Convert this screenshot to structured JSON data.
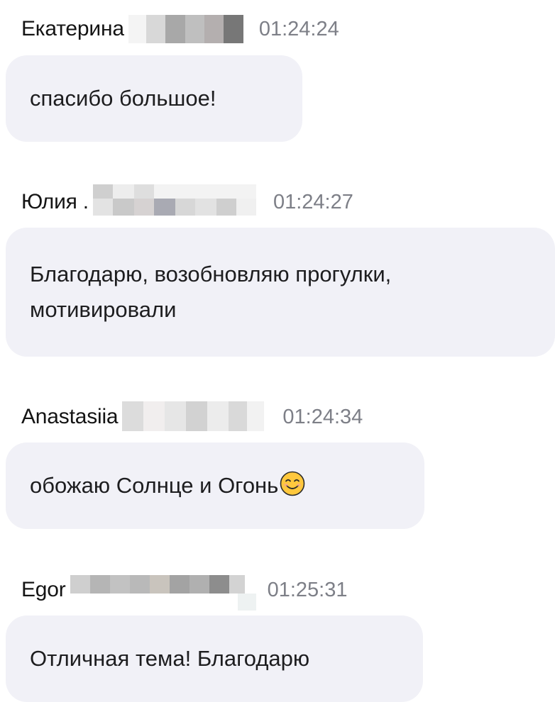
{
  "messages": [
    {
      "author": "Екатерина",
      "time": "01:24:24",
      "text": "спасибо большое!"
    },
    {
      "author": "Юлия .",
      "time": "01:24:27",
      "text": "Благодарю, возобновляю прогулки, мотивировали"
    },
    {
      "author": "Anastasiia",
      "time": "01:24:34",
      "text": "обожаю Солнце и Огонь",
      "emoji": "smiling-face-icon"
    },
    {
      "author": "Egor",
      "time": "01:25:31",
      "text": "Отличная тема! Благодарю"
    }
  ],
  "colors": {
    "bubble": "#f1f1f7",
    "author": "#141414",
    "time": "#7d7f87",
    "emoji_face": "#ffc83d"
  }
}
